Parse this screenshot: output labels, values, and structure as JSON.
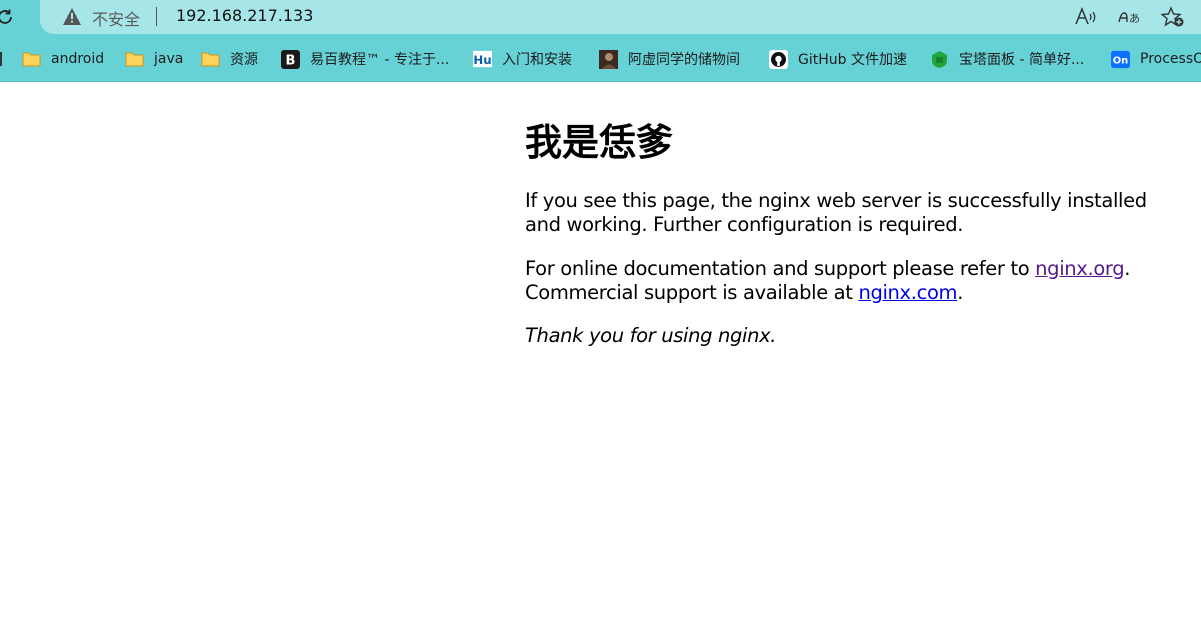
{
  "browser": {
    "security_label": "不安全",
    "url": "192.168.217.133",
    "icons": {
      "reload": "reload-icon",
      "warning": "warning-icon",
      "read_aloud": "read-aloud-icon",
      "translate": "translate-icon",
      "favorite": "add-favorite-icon"
    },
    "theme_color": "#67d2d6"
  },
  "bookmarks": [
    {
      "label": "android",
      "icon": "folder-icon"
    },
    {
      "label": "java",
      "icon": "folder-icon"
    },
    {
      "label": "资源",
      "icon": "folder-icon"
    },
    {
      "label": "易百教程™ - 专注于...",
      "icon": "b-logo-icon"
    },
    {
      "label": "入门和安装",
      "icon": "hu-logo-icon"
    },
    {
      "label": "阿虚同学的储物间",
      "icon": "avatar-icon"
    },
    {
      "label": "GitHub 文件加速",
      "icon": "github-icon"
    },
    {
      "label": "宝塔面板 - 简单好...",
      "icon": "baota-icon"
    },
    {
      "label": "ProcessOn",
      "icon": "processon-icon"
    }
  ],
  "page": {
    "title": "我是恁爹",
    "p1": "If you see this page, the nginx web server is successfully installed and working. Further configuration is required.",
    "p2_a": "For online documentation and support please refer to ",
    "p2_link1": "nginx.org",
    "p2_b": ".",
    "p2_c": "Commercial support is available at ",
    "p2_link2": "nginx.com",
    "p2_d": ".",
    "p3": "Thank you for using nginx."
  }
}
